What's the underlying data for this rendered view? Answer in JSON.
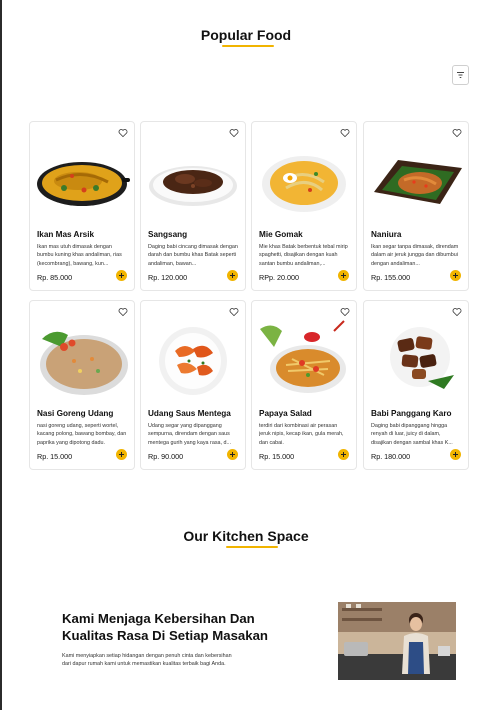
{
  "popular": {
    "title": "Popular Food",
    "accent": "#f1b400",
    "filter_icon": "filter-lines-icon"
  },
  "foods": [
    {
      "name": "Ikan Mas Arsik",
      "description": "Ikan mas utuh dimasak dengan bumbu kuning khas andaliman, rias (kecombrang), bawang, kun...",
      "price": "Rp. 85.000",
      "image": "fish-curry-pan"
    },
    {
      "name": "Sangsang",
      "description": "Daging babi cincang dimasak dengan darah dan bumbu khas Batak seperti andaliman, bawan...",
      "price": "Rp. 120.000",
      "image": "dark-meat-stew"
    },
    {
      "name": "Mie Gomak",
      "description": "Mie khas Batak berbentuk tebal mirip spaghetti, disajikan dengan kuah santan bumbu andaliman,...",
      "price": "RPp. 20.000",
      "image": "noodle-soup-bowl"
    },
    {
      "name": "Naniura",
      "description": "Ikan segar tanpa dimasak, direndam dalam air jeruk jungga dan dibumbui dengan andaliman...",
      "price": "Rp. 155.000",
      "image": "fish-on-leaf"
    },
    {
      "name": "Nasi Goreng Udang",
      "description": "nasi goreng udang, seperti wortel, kacang polong, bawang bombay, dan paprika yang dipotong dadu.",
      "price": "Rp. 15.000",
      "image": "fried-rice-plate"
    },
    {
      "name": "Udang Saus Mentega",
      "description": "Udang segar yang dipanggang sempurna, direndam dengan saus mentega gurih yang kaya rasa, d...",
      "price": "Rp. 90.000",
      "image": "butter-shrimp"
    },
    {
      "name": "Papaya Salad",
      "description": "terdiri dari kombinasi air perasan jeruk nipis, kecap ikan, gula merah, dan cabai.",
      "price": "Rp. 15.000",
      "image": "papaya-salad"
    },
    {
      "name": "Babi Panggang Karo",
      "description": "Daging babi dipanggang hingga renyah di luar, juicy di dalam, disajikan dengan sambal khas K...",
      "price": "Rp. 180.000",
      "image": "roast-pork"
    }
  ],
  "kitchen": {
    "title": "Our Kitchen Space",
    "heading": "Kami Menjaga Kebersihan Dan Kualitas Rasa Di Setiap Masakan",
    "text": "Kami menyiapkan setiap hidangan dengan penuh cinta dan kebersihan dari dapur rumah kami untuk memastikan kualitas terbaik bagi Anda.",
    "image": "barista-kitchen-photo"
  }
}
